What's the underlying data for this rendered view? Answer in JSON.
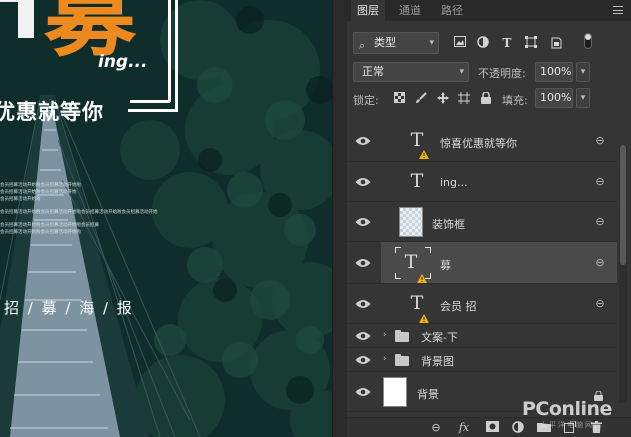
{
  "canvas": {
    "big_char": "募",
    "ing_text": "ing...",
    "slogan": "优惠就等你",
    "fine_lines": [
      "会员招募活动开始啦会员招募活动开始啦",
      "会员招募活动开始啦会员招募活动开始",
      "会员招募活动开始啦",
      "会员招募活动开始啦会员招募活动开始啦会员招募活动开始啦会员招募活动开始",
      "会员招募活动开始啦会员招募活动开始啦会员招募",
      "会员招募活动开始啦会员招募活动开始啦"
    ],
    "tagline": "招 / 募 / 海 / 报"
  },
  "panel": {
    "tabs": [
      {
        "label": "图层",
        "active": true
      },
      {
        "label": "通道",
        "active": false
      },
      {
        "label": "路径",
        "active": false
      }
    ],
    "filter": {
      "kind_label": "类型"
    },
    "blend_mode": "正常",
    "opacity_label": "不透明度:",
    "opacity_value": "100%",
    "lock_label": "锁定:",
    "fill_label": "填充:",
    "fill_value": "100%",
    "layers": [
      {
        "name": "惊喜优惠就等你",
        "type": "text",
        "visible": true,
        "warning": true,
        "linked": true,
        "selected": false
      },
      {
        "name": "ing...",
        "type": "text",
        "visible": true,
        "warning": false,
        "linked": true,
        "selected": false
      },
      {
        "name": "装饰框",
        "type": "shape",
        "visible": true,
        "warning": false,
        "linked": true,
        "selected": false
      },
      {
        "name": "募",
        "type": "text",
        "visible": true,
        "warning": true,
        "linked": true,
        "selected": true
      },
      {
        "name": "会员 招",
        "type": "text",
        "visible": true,
        "warning": true,
        "linked": true,
        "selected": false
      },
      {
        "name": "文案-下",
        "type": "group",
        "visible": true,
        "collapsed": true
      },
      {
        "name": "背景图",
        "type": "group",
        "visible": true,
        "collapsed": true
      },
      {
        "name": "背景",
        "type": "background",
        "visible": true,
        "locked": true
      }
    ]
  },
  "watermark": {
    "brand": "PConline",
    "sub": "太平洋电脑网"
  },
  "colors": {
    "accent_orange": "#ec8a20",
    "panel_bg": "#353535",
    "selected_row": "#4a4a4a",
    "warning": "#f0b400"
  }
}
